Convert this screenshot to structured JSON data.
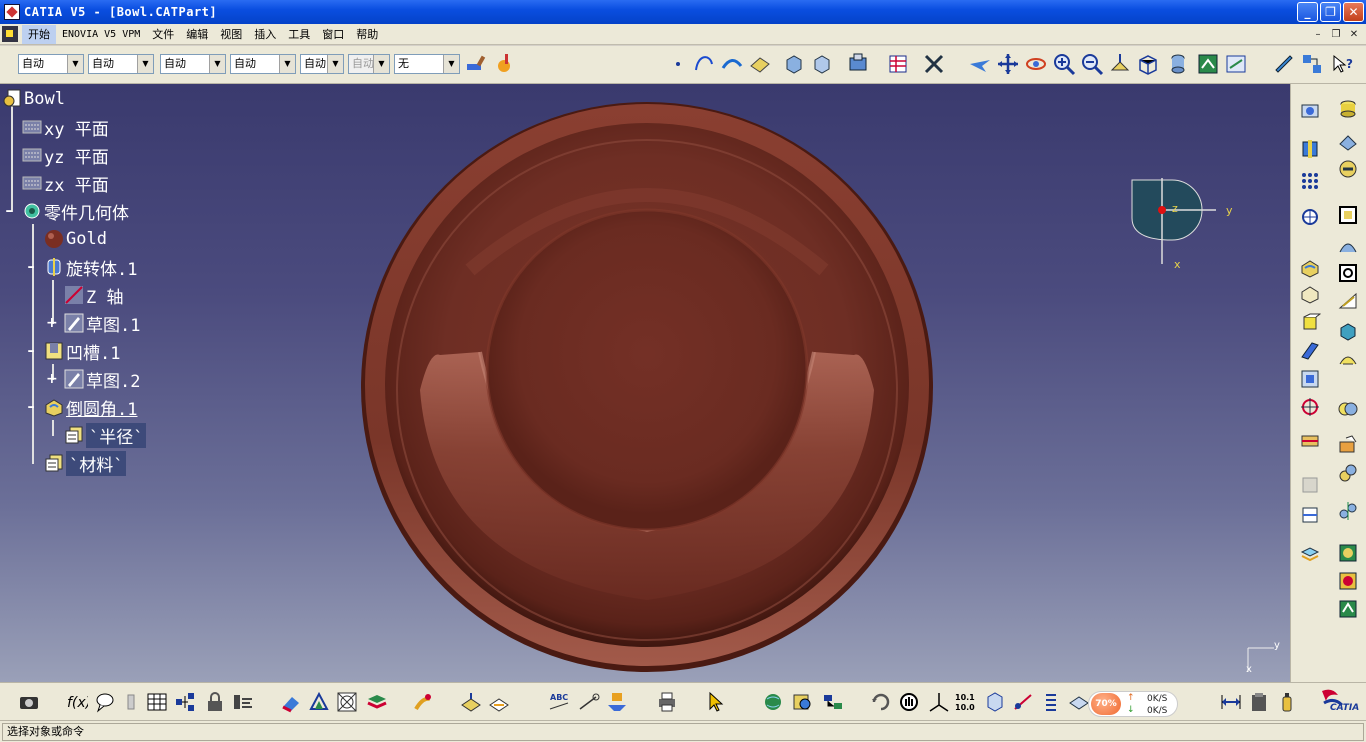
{
  "window": {
    "title": "CATIA V5 - [Bowl.CATPart]",
    "minimize": "_",
    "restore": "❐",
    "close": "✕"
  },
  "menu": {
    "items": [
      "开始",
      "ENOVIA V5 VPM",
      "文件",
      "编辑",
      "视图",
      "插入",
      "工具",
      "窗口",
      "帮助"
    ],
    "doc_minimize": "–",
    "doc_restore": "❐",
    "doc_close": "✕"
  },
  "toolbar": {
    "combos": [
      "自动",
      "自动",
      "自动",
      "自动",
      "自动",
      "自动",
      "无"
    ]
  },
  "tree": {
    "root": "Bowl",
    "planes": [
      "xy 平面",
      "yz 平面",
      "zx 平面"
    ],
    "body": "零件几何体",
    "material_gold": "Gold",
    "shaft": "旋转体.1",
    "axis": "Z 轴",
    "sketch1": "草图.1",
    "groove": "凹槽.1",
    "sketch2": "草图.2",
    "fillet": "倒圆角.1",
    "radius_param": "`半径`",
    "material_param": "`材料`"
  },
  "compass": {
    "z_label": "z",
    "y_label": "y",
    "x_label": "x"
  },
  "corner_axis": {
    "y_label": "y",
    "x_label": "x"
  },
  "speed": {
    "percent": "70%",
    "up_rate": "0K/S",
    "down_rate": "0K/S"
  },
  "status": {
    "prompt": "选择对象或命令"
  },
  "colors": {
    "bowl": "#6e2e24",
    "viewport_top": "#3a3a6e",
    "viewport_bottom": "#9aa0b8",
    "compass_fill": "#234a5c",
    "label_yellow": "#e8d24a"
  },
  "logo": {
    "brand": "CATIA"
  }
}
